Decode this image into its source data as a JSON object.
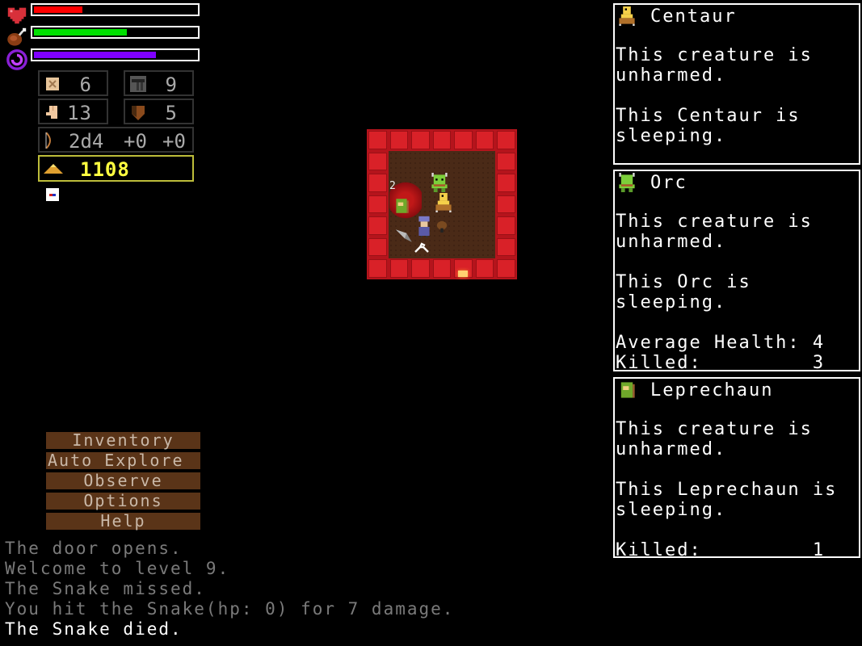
{
  "hud": {
    "bars": [
      {
        "name": "health",
        "icon": "heart-icon",
        "fill_fraction": 0.3,
        "color": "#ff0000"
      },
      {
        "name": "hunger",
        "icon": "meat-icon",
        "fill_fraction": 0.57,
        "color": "#00e000"
      },
      {
        "name": "mana",
        "icon": "spiral-icon",
        "fill_fraction": 0.75,
        "color": "#7f00ff"
      }
    ],
    "stats": {
      "scroll": "6",
      "depth": "9",
      "strength": "13",
      "armor": "5",
      "weapon_dice": "2d4",
      "weapon_hit": "+0",
      "weapon_dmg": "+0",
      "gold": "1108"
    },
    "colors": {
      "gold_text": "#ffff40",
      "gold_border": "#bdbd3a"
    }
  },
  "menu": {
    "items": [
      "Inventory",
      "Auto Explore",
      "Observe",
      "Options",
      "Help"
    ]
  },
  "log": {
    "messages": [
      {
        "text": "The door opens.",
        "color": "#7a7a7a"
      },
      {
        "text": "Welcome to level 9.",
        "color": "#7a7a7a"
      },
      {
        "text": "The Snake missed.",
        "color": "#7a7a7a"
      },
      {
        "text": "You hit the Snake(hp: 0) for 7 damage.",
        "color": "#7a7a7a"
      },
      {
        "text": "The Snake died.",
        "color": "#ffffff"
      }
    ]
  },
  "creatures": [
    {
      "name": "Centaur",
      "icon": "centaur-icon",
      "lines": [
        "This creature is",
        "unharmed.",
        "",
        "This Centaur is",
        "sleeping."
      ]
    },
    {
      "name": "Orc",
      "icon": "orc-icon",
      "lines": [
        "This creature is",
        "unharmed.",
        "",
        "This Orc is",
        "sleeping.",
        "",
        "Average Health: 4",
        "Killed:         3"
      ]
    },
    {
      "name": "Leprechaun",
      "icon": "leprechaun-icon",
      "lines": [
        "This creature is",
        "unharmed.",
        "",
        "This Leprechaun is",
        "sleeping.",
        "",
        "Killed:         1"
      ]
    }
  ],
  "map": {
    "floor_number_marker": "2"
  }
}
